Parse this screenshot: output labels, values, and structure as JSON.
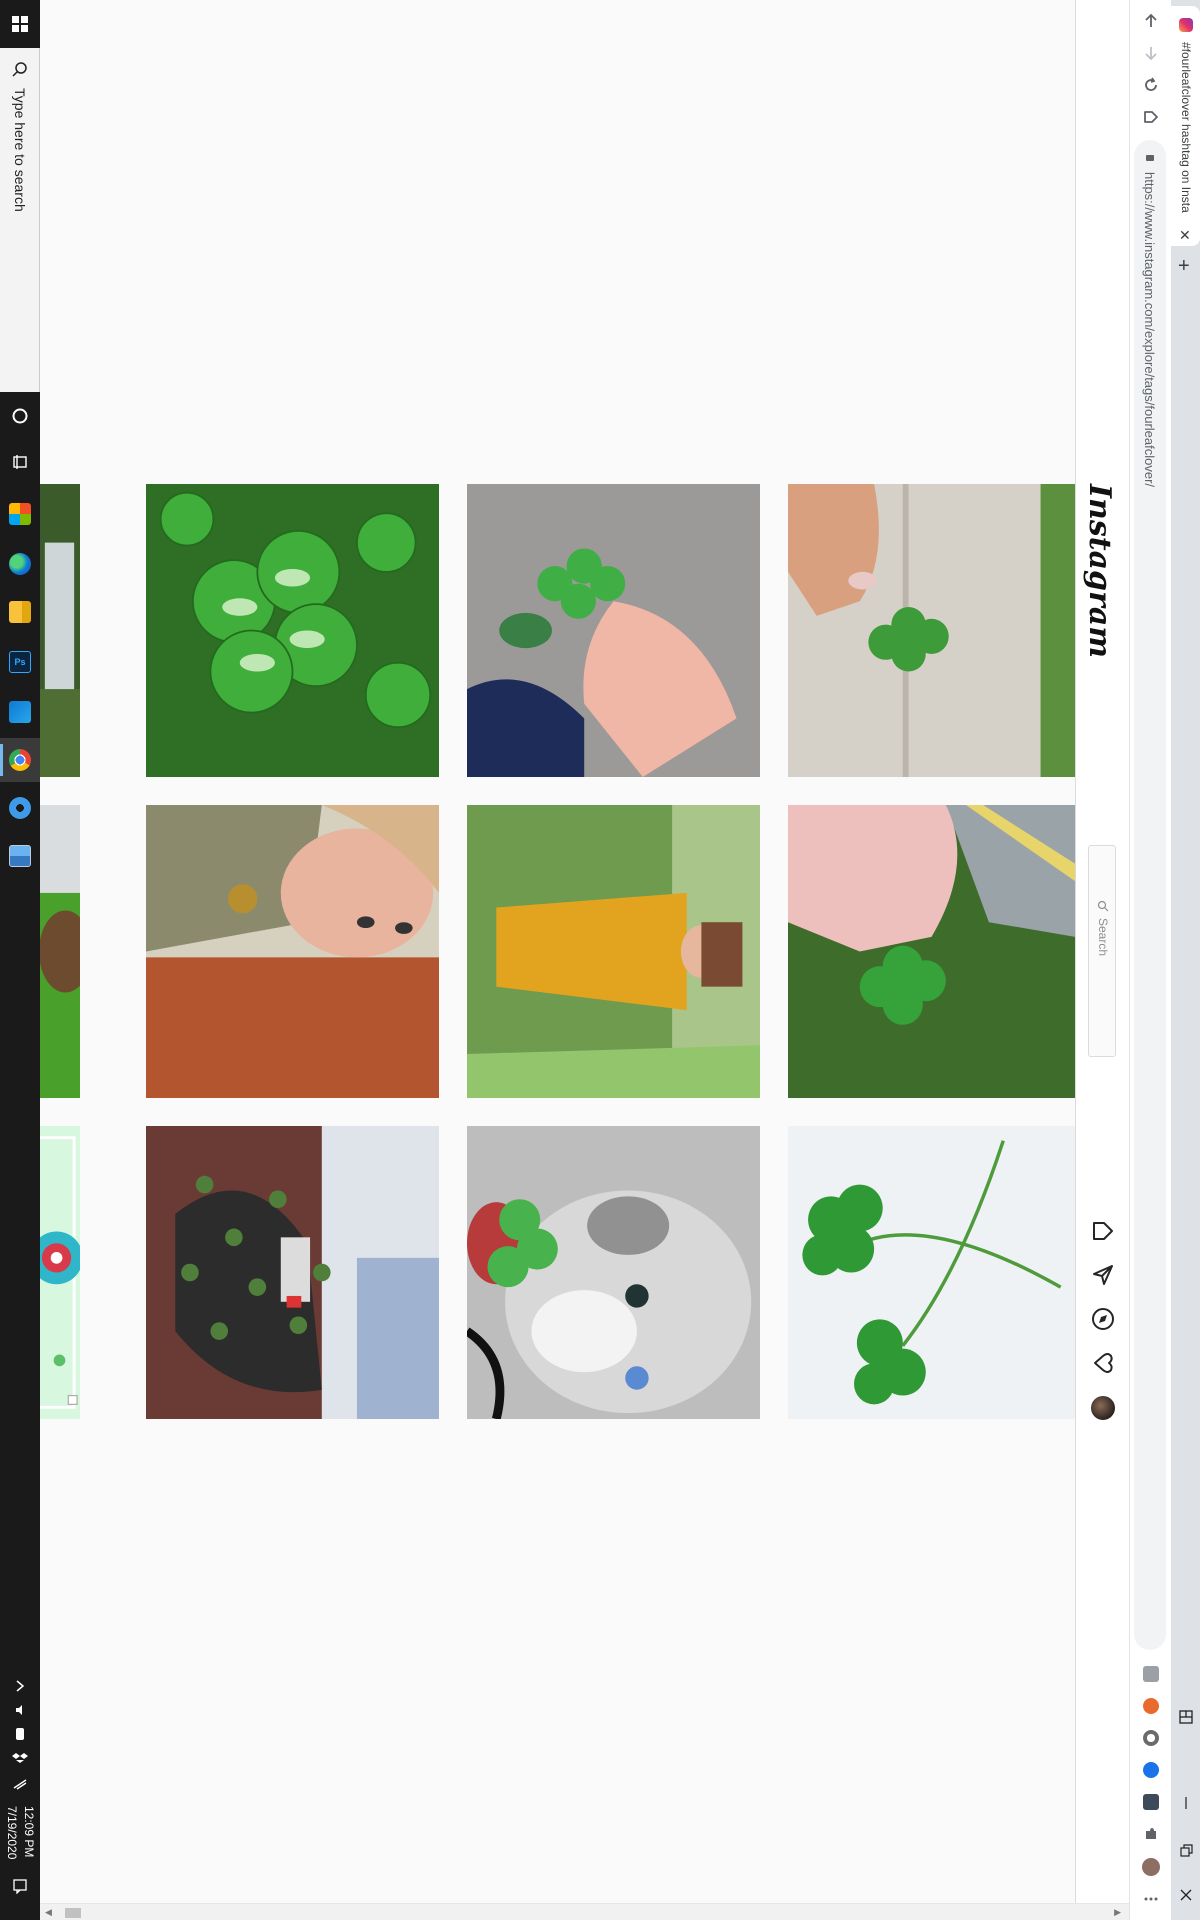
{
  "taskbar": {
    "search_placeholder": "Type here to search",
    "time": "12:09 PM",
    "date": "7/19/2020"
  },
  "browser": {
    "tab_title": "#fourleafclover hashtag on Insta",
    "url": "https://www.instagram.com/explore/tags/fourleafclover/",
    "tab_close": "✕",
    "new_tab": "+"
  },
  "instagram": {
    "logo": "Instagram",
    "search_placeholder": "Search"
  },
  "photos": [
    {
      "name": "partial-photo-street"
    },
    {
      "name": "photo-clover-leaves-closeup"
    },
    {
      "name": "photo-hand-holding-clover-shoes"
    },
    {
      "name": "photo-hand-holding-clover-sidewalk"
    },
    {
      "name": "partial-photo-dog-grass"
    },
    {
      "name": "photo-woman-clover-necklace"
    },
    {
      "name": "photo-woman-yellow-lace-dress"
    },
    {
      "name": "photo-fingers-holding-clover-road"
    },
    {
      "name": "partial-photo-illustration"
    },
    {
      "name": "photo-potted-clover-plant"
    },
    {
      "name": "photo-husky-with-clover"
    },
    {
      "name": "photo-two-clovers-white-background"
    }
  ],
  "colors": {
    "taskbar": "#1a1a1a",
    "page_bg": "#fafafa",
    "clover_green": "#3aa53a"
  }
}
